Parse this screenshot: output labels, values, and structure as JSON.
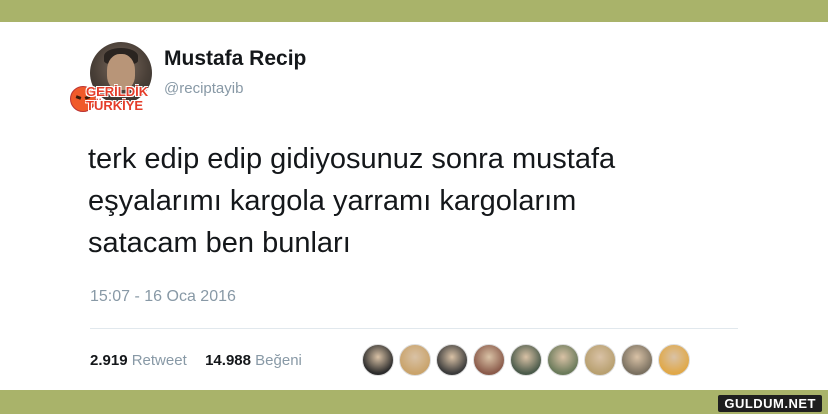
{
  "user": {
    "name": "Mustafa Recip",
    "handle": "@reciptayib",
    "badge_line1": "GERİLDİK",
    "badge_line2": "TÜRKİYE"
  },
  "tweet": {
    "lines": [
      "terk edip edip gidiyosunuz sonra mustafa",
      "eşyalarımı kargola yarramı kargolarım",
      "satacam ben bunları"
    ],
    "timestamp": "15:07 - 16 Oca 2016"
  },
  "stats": {
    "retweet_count": "2.919",
    "retweet_label": "Retweet",
    "like_count": "14.988",
    "like_label": "Beğeni"
  },
  "liker_avatars": [
    {
      "color": "#2b2b2b"
    },
    {
      "color": "#c9a36b"
    },
    {
      "color": "#3a3a3a"
    },
    {
      "color": "#8a5a4a"
    },
    {
      "color": "#4a5a4a"
    },
    {
      "color": "#6a7a5a"
    },
    {
      "color": "#b8a070"
    },
    {
      "color": "#7a7060"
    },
    {
      "color": "#e0a848"
    }
  ],
  "colors": {
    "background": "#a9b36a",
    "card": "#ffffff",
    "text": "#14171a",
    "muted": "#8899a6"
  },
  "watermark": "GULDUM.NET"
}
